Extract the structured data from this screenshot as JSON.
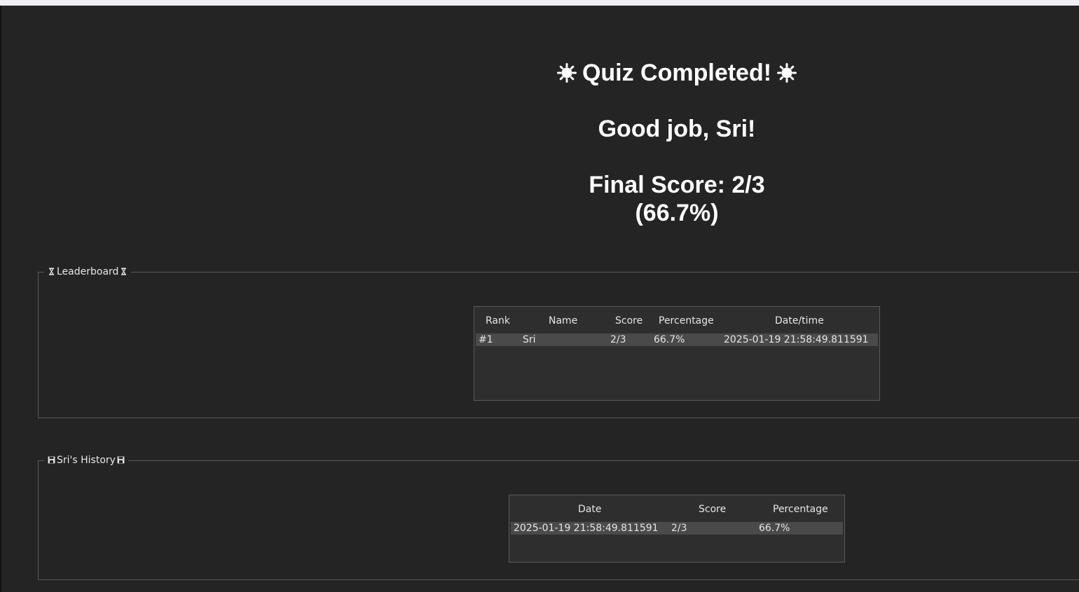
{
  "result": {
    "title": "Quiz Completed!",
    "greeting": "Good job, Sri!",
    "score_line1": "Final Score: 2/3",
    "score_line2": "(66.7%)",
    "decor_icon": "sun-icon"
  },
  "leaderboard": {
    "title": "Leaderboard",
    "icon": "hourglass-icon",
    "columns": [
      "Rank",
      "Name",
      "Score",
      "Percentage",
      "Date/time"
    ],
    "rows": [
      [
        "#1",
        "Sri",
        "2/3",
        "66.7%",
        "2025-01-19 21:58:49.811591"
      ]
    ]
  },
  "history": {
    "title": "Sri's History",
    "icon": "save-icon",
    "columns": [
      "Date",
      "Score",
      "Percentage"
    ],
    "rows": [
      [
        "2025-01-19 21:58:49.811591",
        "2/3",
        "66.7%"
      ]
    ]
  },
  "colors": {
    "background": "#242424",
    "table_bg": "#2e2e2e",
    "selected_row": "#4a4a4a",
    "text": "#ffffff"
  }
}
